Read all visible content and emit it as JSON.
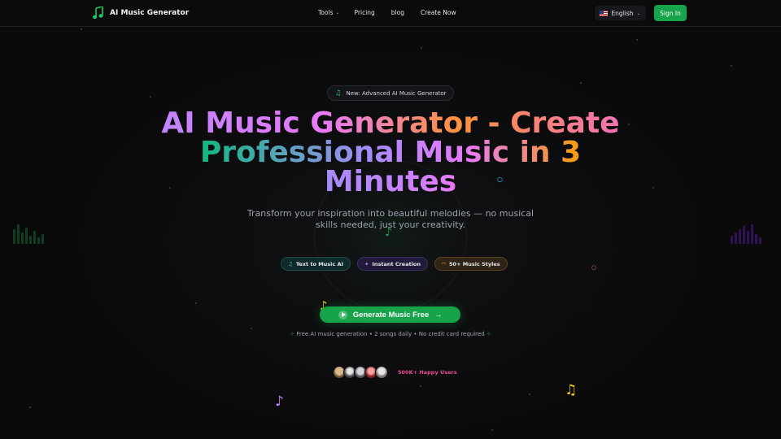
{
  "header": {
    "brand": "AI Music Generator",
    "nav": [
      "Tools",
      "Pricing",
      "blog",
      "Create Now"
    ],
    "language": "English",
    "signin_label": "Sign In"
  },
  "hero": {
    "badge": "New: Advanced AI Music Generator",
    "title_line1": "AI Music Generator - Create",
    "title_line2": "Professional Music in 3",
    "title_line3": "Minutes",
    "subtitle": "Transform your inspiration into beautiful melodies — no musical skills needed, just your creativity.",
    "features": [
      "Text to Music AI",
      "Instant Creation",
      "50+ Music Styles"
    ],
    "cta_label": "Generate Music Free",
    "cta_note": "Free AI music generation • 2 songs daily • No credit card required",
    "users_label": "500K+ Happy Users"
  },
  "colors": {
    "accent": "#16a34a",
    "background": "#0a0a0b",
    "users_label": "#ec4899"
  },
  "icons": [
    "music-note-icon",
    "chevron-down-icon",
    "us-flag-icon",
    "play-icon",
    "arrow-right-icon",
    "sparkle-icon",
    "magic-wand-icon",
    "headphones-icon"
  ]
}
